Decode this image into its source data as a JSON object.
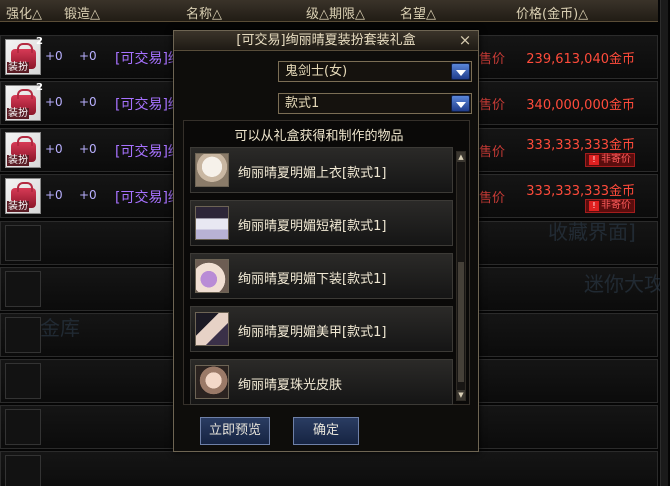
{
  "header": {
    "enhance": "强化△",
    "forge": "锻造△",
    "name": "名称△",
    "level_limit": "级△期限△",
    "fame": "名望△",
    "price": "价格(金币)△"
  },
  "listings": [
    {
      "count": "2",
      "icon_label": "装扮",
      "enhance": "+0",
      "forge": "+0",
      "name": "[可交易]绚丽晴夏装扮套",
      "price_type": "售价",
      "price": "239,613,040金币",
      "tag": ""
    },
    {
      "count": "2",
      "icon_label": "装扮",
      "enhance": "+0",
      "forge": "+0",
      "name": "[可交易]绚丽晴夏装扮套",
      "price_type": "售价",
      "price": "340,000,000金币",
      "tag": ""
    },
    {
      "count": "",
      "icon_label": "装扮",
      "enhance": "+0",
      "forge": "+0",
      "name": "[可交易]绚",
      "price_type": "售价",
      "price": "333,333,333金币",
      "tag": "非寄价"
    },
    {
      "count": "",
      "icon_label": "装扮",
      "enhance": "+0",
      "forge": "+0",
      "name": "[可交易]绚",
      "price_type": "售价",
      "price": "333,333,333金币",
      "tag": "非寄价"
    }
  ],
  "dialog": {
    "title": "[可交易]绚丽晴夏装扮套装礼盒",
    "close": "×",
    "job_select": "鬼剑士(女)",
    "style_select": "款式1",
    "panel_header": "可以从礼盒获得和制作的物品",
    "items": [
      {
        "name": "绚丽晴夏明媚上衣[款式1]",
        "icon": "coat-icon"
      },
      {
        "name": "绚丽晴夏明媚短裙[款式1]",
        "icon": "skirt-icon"
      },
      {
        "name": "绚丽晴夏明媚下装[款式1]",
        "icon": "pants-icon"
      },
      {
        "name": "绚丽晴夏明媚美甲[款式1]",
        "icon": "nail-icon"
      },
      {
        "name": "绚丽晴夏珠光皮肤",
        "icon": "skin-icon"
      }
    ],
    "preview_button": "立即预览",
    "confirm_button": "确定"
  },
  "background_text": [
    "收藏界面]",
    "迷你大攻",
    "金库"
  ],
  "colors": {
    "item_name": "#a772ff",
    "price": "#ff4b3b",
    "button": "#1f3154",
    "accent_select": "#3c6fd0"
  }
}
